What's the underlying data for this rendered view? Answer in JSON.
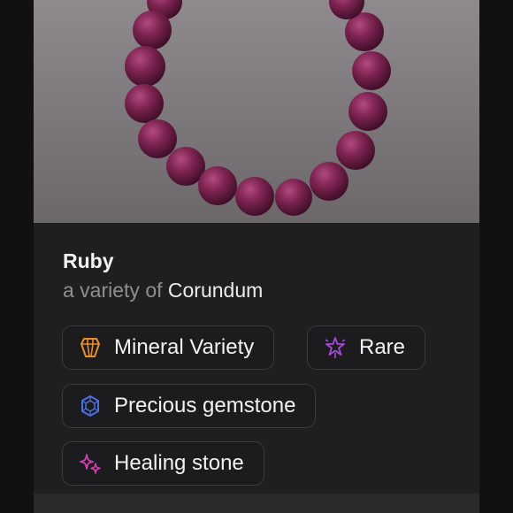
{
  "item": {
    "name": "Ruby",
    "variety_prefix": "a variety of",
    "variety_of": "Corundum"
  },
  "tags": [
    {
      "label": "Mineral Variety",
      "icon": "crystal-icon",
      "color": "#e8902a"
    },
    {
      "label": "Rare",
      "icon": "sparkle-star-icon",
      "color": "#a44be0"
    },
    {
      "label": "Precious gemstone",
      "icon": "gem-icon",
      "color": "#4a6fe0"
    },
    {
      "label": "Healing stone",
      "icon": "sparkles-icon",
      "color": "#d63fb4"
    }
  ],
  "photo": {
    "subject": "ruby-bead-bracelet",
    "bead_color": "#7e2452"
  }
}
